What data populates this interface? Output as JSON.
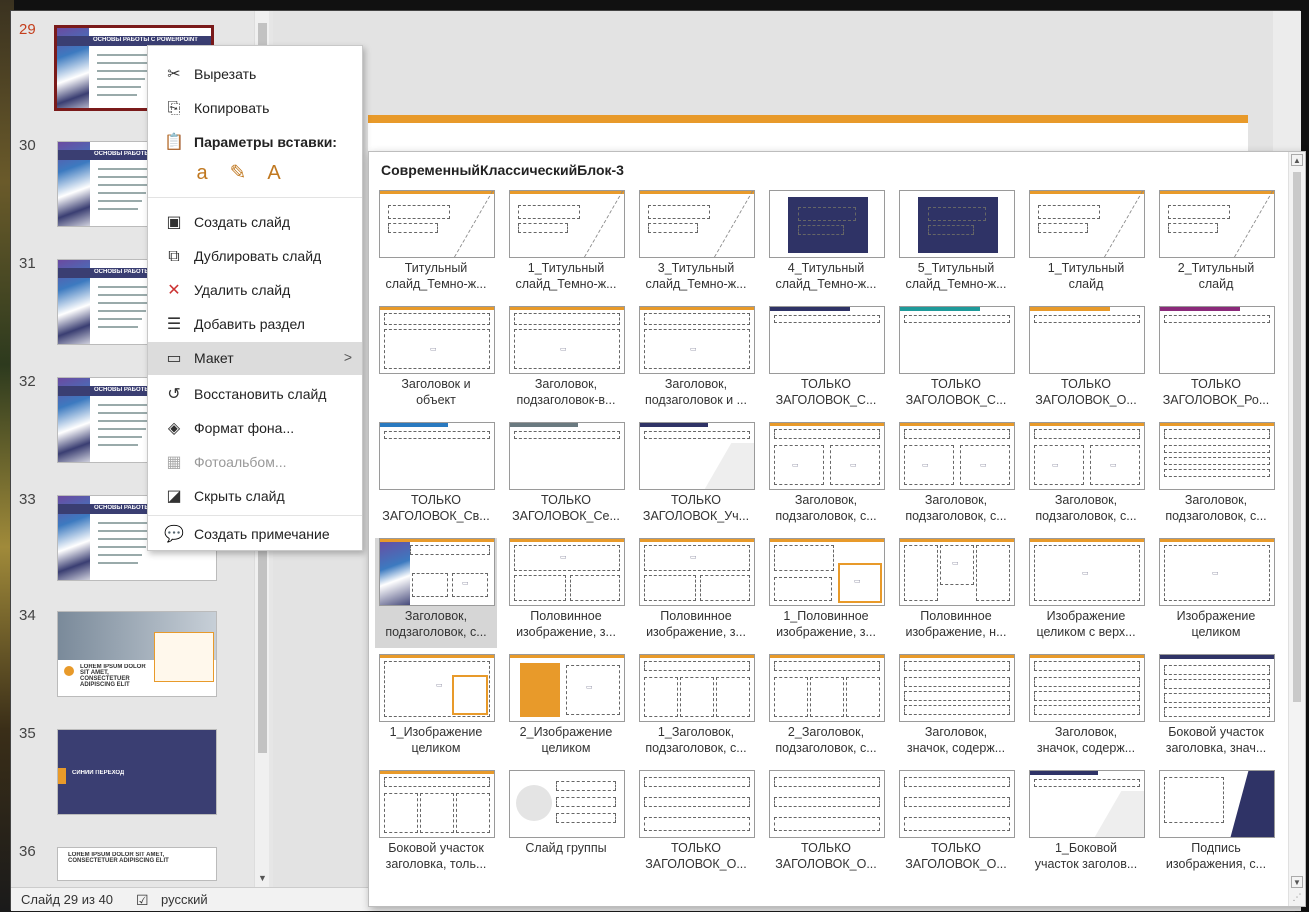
{
  "thumbnails": [
    {
      "num": "29",
      "title": "ОСНОВЫ РАБОТЫ С POWERPOINT",
      "selected": true
    },
    {
      "num": "30",
      "title": "ОСНОВЫ РАБОТЫ С POWERPOINT",
      "selected": false
    },
    {
      "num": "31",
      "title": "ОСНОВЫ РАБОТЫ С POWERPOINT",
      "selected": false
    },
    {
      "num": "32",
      "title": "ОСНОВЫ РАБОТЫ С POWERPOINT",
      "selected": false
    },
    {
      "num": "33",
      "title": "ОСНОВЫ РАБОТЫ С POWERPOINT",
      "selected": false
    },
    {
      "num": "34",
      "title": "LOREM IPSUM DOLOR SIT AMET, CONSECTETUER ADIPISCING ELIT",
      "selected": false
    },
    {
      "num": "35",
      "title": "СИНИЙ ПЕРЕХОД",
      "selected": false
    },
    {
      "num": "36",
      "title": "LOREM IPSUM DOLOR SIT AMET, CONSECTETUER ADIPISCING ELIT",
      "selected": false
    }
  ],
  "context_menu": {
    "cut": "Вырезать",
    "copy": "Копировать",
    "paste_options": "Параметры вставки:",
    "new_slide": "Создать слайд",
    "duplicate_slide": "Дублировать слайд",
    "delete_slide": "Удалить слайд",
    "add_section": "Добавить раздел",
    "layout": "Макет",
    "reset_slide": "Восстановить слайд",
    "format_background": "Формат фона...",
    "photo_album": "Фотоальбом...",
    "hide_slide": "Скрыть слайд",
    "new_comment": "Создать примечание"
  },
  "gallery": {
    "heading": "СовременныйКлассическийБлок-3",
    "layouts": [
      {
        "l1": "Титульный",
        "l2": "слайд_Темно-ж...",
        "kind": "title"
      },
      {
        "l1": "1_Титульный",
        "l2": "слайд_Темно-ж...",
        "kind": "title"
      },
      {
        "l1": "3_Титульный",
        "l2": "слайд_Темно-ж...",
        "kind": "title"
      },
      {
        "l1": "4_Титульный",
        "l2": "слайд_Темно-ж...",
        "kind": "navy"
      },
      {
        "l1": "5_Титульный",
        "l2": "слайд_Темно-ж...",
        "kind": "navy"
      },
      {
        "l1": "1_Титульный",
        "l2": "слайд",
        "kind": "title"
      },
      {
        "l1": "2_Титульный",
        "l2": "слайд",
        "kind": "title"
      },
      {
        "l1": "Заголовок и",
        "l2": "объект",
        "kind": "content"
      },
      {
        "l1": "Заголовок,",
        "l2": "подзаголовок-в...",
        "kind": "content"
      },
      {
        "l1": "Заголовок,",
        "l2": "подзаголовок и ...",
        "kind": "content"
      },
      {
        "l1": "ТОЛЬКО",
        "l2": "ЗАГОЛОВОК_С...",
        "kind": "bar-navy"
      },
      {
        "l1": "ТОЛЬКО",
        "l2": "ЗАГОЛОВОК_С...",
        "kind": "bar-teal"
      },
      {
        "l1": "ТОЛЬКО",
        "l2": "ЗАГОЛОВОК_О...",
        "kind": "bar-orange"
      },
      {
        "l1": "ТОЛЬКО",
        "l2": "ЗАГОЛОВОК_Ро...",
        "kind": "bar-purple"
      },
      {
        "l1": "ТОЛЬКО",
        "l2": "ЗАГОЛОВОК_Св...",
        "kind": "bar-blue"
      },
      {
        "l1": "ТОЛЬКО",
        "l2": "ЗАГОЛОВОК_Се...",
        "kind": "bar-gray"
      },
      {
        "l1": "ТОЛЬКО",
        "l2": "ЗАГОЛОВОК_Уч...",
        "kind": "bar-diag"
      },
      {
        "l1": "Заголовок,",
        "l2": "подзаголовок, с...",
        "kind": "two"
      },
      {
        "l1": "Заголовок,",
        "l2": "подзаголовок, с...",
        "kind": "two"
      },
      {
        "l1": "Заголовок,",
        "l2": "подзаголовок, с...",
        "kind": "two"
      },
      {
        "l1": "Заголовок,",
        "l2": "подзаголовок, с...",
        "kind": "lines"
      },
      {
        "l1": "Заголовок,",
        "l2": "подзаголовок, с...",
        "kind": "selected"
      },
      {
        "l1": "Половинное",
        "l2": "изображение, з...",
        "kind": "half"
      },
      {
        "l1": "Половинное",
        "l2": "изображение, з...",
        "kind": "half"
      },
      {
        "l1": "1_Половинное",
        "l2": "изображение, з...",
        "kind": "half-orange"
      },
      {
        "l1": "Половинное",
        "l2": "изображение, н...",
        "kind": "grid"
      },
      {
        "l1": "Изображение",
        "l2": "целиком с верх...",
        "kind": "full"
      },
      {
        "l1": "Изображение",
        "l2": "целиком",
        "kind": "full"
      },
      {
        "l1": "1_Изображение",
        "l2": "целиком",
        "kind": "full-orange"
      },
      {
        "l1": "2_Изображение",
        "l2": "целиком",
        "kind": "orange-block"
      },
      {
        "l1": "1_Заголовок,",
        "l2": "подзаголовок, с...",
        "kind": "three"
      },
      {
        "l1": "2_Заголовок,",
        "l2": "подзаголовок, с...",
        "kind": "three"
      },
      {
        "l1": "Заголовок,",
        "l2": "значок, содерж...",
        "kind": "icons"
      },
      {
        "l1": "Заголовок,",
        "l2": "значок, содерж...",
        "kind": "icons"
      },
      {
        "l1": "Боковой участок",
        "l2": "заголовка, знач...",
        "kind": "side"
      },
      {
        "l1": "Боковой участок",
        "l2": "заголовка, толь...",
        "kind": "three"
      },
      {
        "l1": "Слайд группы",
        "l2": "",
        "kind": "group"
      },
      {
        "l1": "ТОЛЬКО",
        "l2": "ЗАГОЛОВОК_О...",
        "kind": "timeline"
      },
      {
        "l1": "ТОЛЬКО",
        "l2": "ЗАГОЛОВОК_О...",
        "kind": "timeline"
      },
      {
        "l1": "ТОЛЬКО",
        "l2": "ЗАГОЛОВОК_О...",
        "kind": "timeline"
      },
      {
        "l1": "1_Боковой",
        "l2": "участок заголов...",
        "kind": "bar-diag"
      },
      {
        "l1": "Подпись",
        "l2": "изображения, с...",
        "kind": "caption"
      }
    ]
  },
  "status": {
    "slide_counter": "Слайд 29 из 40",
    "language": "русский"
  },
  "colors": {
    "navy": "#2f3366",
    "orange": "#e89a2a",
    "teal": "#1f9a9a",
    "purple": "#8a2a7a",
    "blue": "#2a7ac0",
    "selection_border": "#7a1a1a"
  }
}
